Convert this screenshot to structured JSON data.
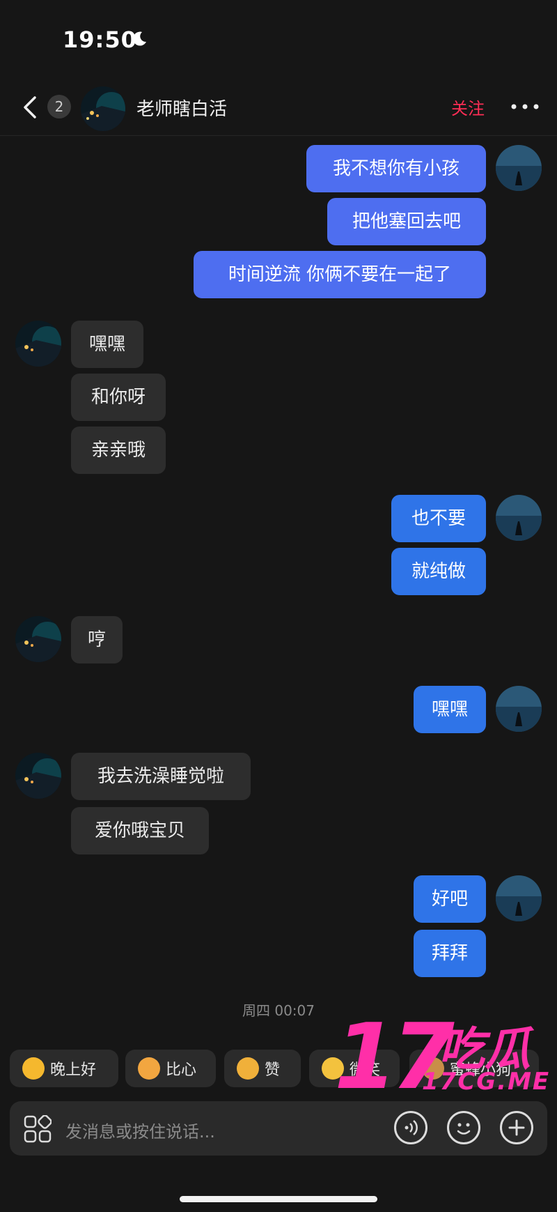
{
  "status_bar": {
    "time": "19:50"
  },
  "header": {
    "unread_count": "2",
    "contact_name": "老师瞎白活",
    "follow_label": "关注"
  },
  "messages": [
    {
      "from": "me",
      "text": "我不想你有小孩"
    },
    {
      "from": "me",
      "text": "把他塞回去吧"
    },
    {
      "from": "me",
      "text": "时间逆流 你俩不要在一起了"
    },
    {
      "from": "them",
      "text": "嘿嘿"
    },
    {
      "from": "them",
      "text": "和你呀"
    },
    {
      "from": "them",
      "text": "亲亲哦"
    },
    {
      "from": "me",
      "text": "也不要"
    },
    {
      "from": "me",
      "text": "就纯做"
    },
    {
      "from": "them",
      "text": "哼"
    },
    {
      "from": "me",
      "text": "嘿嘿"
    },
    {
      "from": "them",
      "text": "我去洗澡睡觉啦"
    },
    {
      "from": "them",
      "text": "爱你哦宝贝"
    },
    {
      "from": "me",
      "text": "好吧"
    },
    {
      "from": "me",
      "text": "拜拜"
    }
  ],
  "timestamp": "周四 00:07",
  "quick_replies": [
    {
      "label": "晚上好",
      "icon": "star-emoji-icon"
    },
    {
      "label": "比心",
      "icon": "heart-hands-emoji-icon"
    },
    {
      "label": "赞",
      "icon": "thumbs-up-emoji-icon"
    },
    {
      "label": "微笑",
      "icon": "smile-emoji-icon"
    },
    {
      "label": "蜜蜂小狗",
      "icon": "bee-dog-emoji-icon"
    }
  ],
  "composer": {
    "placeholder": "发消息或按住说话..."
  },
  "watermark": {
    "number": "17",
    "chinese": "吃瓜",
    "url": "17CG.ME"
  },
  "colors": {
    "background": "#161616",
    "my_bubble": "#4e6ef0",
    "their_bubble": "#2d2d2d",
    "follow": "#ff2d55"
  }
}
